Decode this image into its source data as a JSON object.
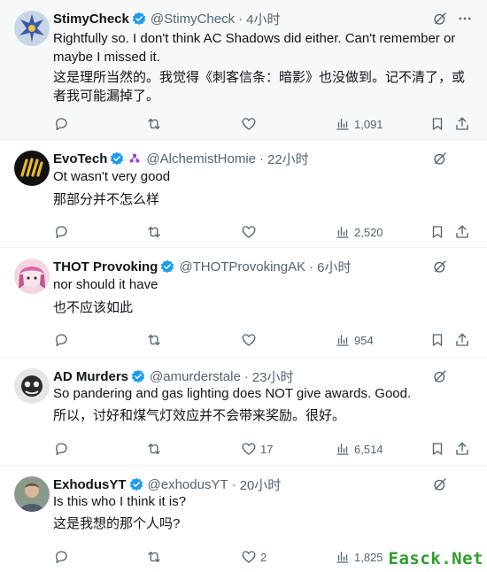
{
  "icons": {
    "reply": "reply-icon",
    "repost": "repost-icon",
    "like": "like-icon",
    "views": "views-icon",
    "bookmark": "bookmark-icon",
    "share": "share-icon",
    "grok": "grok-icon",
    "more": "more-icon",
    "verified": "verified-badge-icon"
  },
  "colors": {
    "verified": "#1d9bf0",
    "text": "#0f1419",
    "secondary": "#536471",
    "highlight_bg": "#f7f9f9"
  },
  "tweets": [
    {
      "name": "StimyCheck",
      "handle": "@StimyCheck",
      "time": "4小时",
      "text_en": "Rightfully so. I don't think AC Shadows did either. Can't remember or maybe I missed it.",
      "text_zh": "这是理所当然的。我觉得《刺客信条：暗影》也没做到。记不清了，或者我可能漏掉了。",
      "replies": "",
      "reposts": "",
      "likes": "",
      "views": "1,091"
    },
    {
      "name": "EvoTech",
      "handle": "@AlchemistHomie",
      "time": "22小时",
      "text_en": "Ot wasn't very good",
      "text_zh": "那部分并不怎么样",
      "replies": "",
      "reposts": "",
      "likes": "",
      "views": "2,520"
    },
    {
      "name": "THOT Provoking",
      "handle": "@THOTProvokingAK",
      "time": "6小时",
      "text_en": "nor should it have",
      "text_zh": "也不应该如此",
      "replies": "",
      "reposts": "",
      "likes": "",
      "views": "954"
    },
    {
      "name": "AD Murders",
      "handle": "@amurderstale",
      "time": "23小时",
      "text_en": "So pandering and gas lighting does NOT give awards. Good.",
      "text_zh": "所以，讨好和煤气灯效应并不会带来奖励。很好。",
      "replies": "",
      "reposts": "",
      "likes": "17",
      "views": "6,514"
    },
    {
      "name": "ExhodusYT",
      "handle": "@exhodusYT",
      "time": "20小时",
      "text_en": "Is this who I think it is?",
      "text_zh": "这是我想的那个人吗?",
      "replies": "",
      "reposts": "",
      "likes": "2",
      "views": "1,825"
    }
  ],
  "watermark": "Easck.Net"
}
